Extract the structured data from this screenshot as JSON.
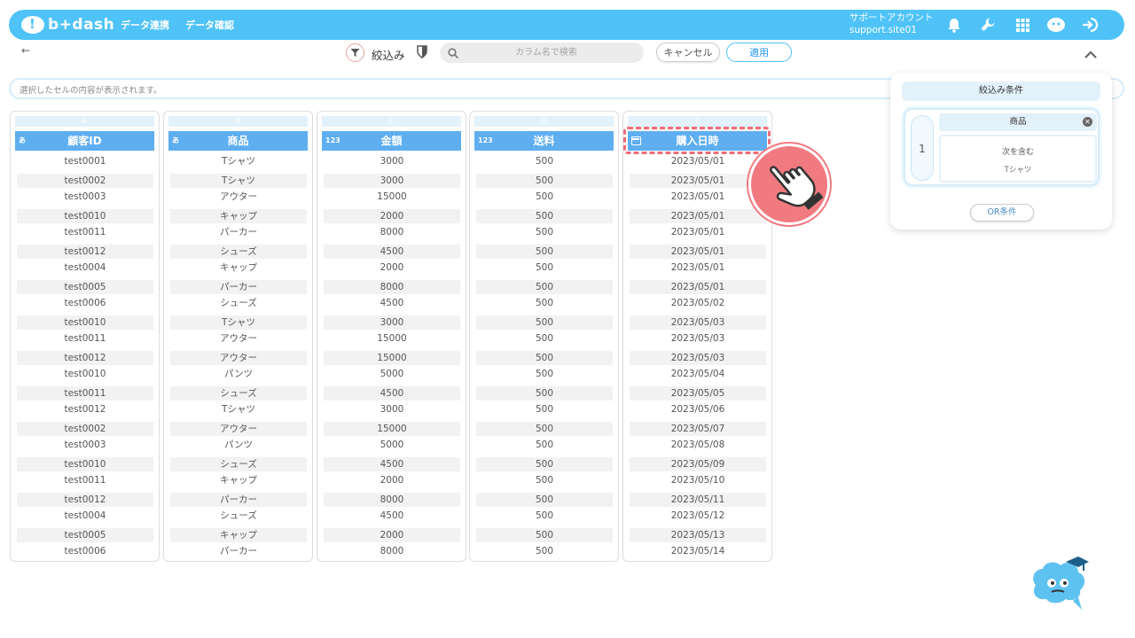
{
  "header": {
    "logo_text": "b+dash",
    "nav": [
      "データ連携",
      "データ確認"
    ],
    "account_name": "サポートアカウント",
    "account_id": "support.site01"
  },
  "toolbar": {
    "back": "←",
    "filter_label": "絞込み",
    "search_placeholder": "カラム名で検索",
    "cancel_label": "キャンセル",
    "apply_label": "適用"
  },
  "info_bar": {
    "text": "選択したセルの内容が表示されます。"
  },
  "columns": [
    {
      "letter": "A",
      "type": "あ",
      "name": "顧客ID",
      "values": [
        "test0001",
        "test0002",
        "test0003",
        "test0010",
        "test0011",
        "test0012",
        "test0004",
        "test0005",
        "test0006",
        "test0010",
        "test0011",
        "test0012",
        "test0010",
        "test0011",
        "test0012",
        "test0002",
        "test0003",
        "test0010",
        "test0011",
        "test0012",
        "test0004",
        "test0005",
        "test0006"
      ]
    },
    {
      "letter": "B",
      "type": "あ",
      "name": "商品",
      "values": [
        "Tシャツ",
        "Tシャツ",
        "アウター",
        "キャップ",
        "パーカー",
        "シューズ",
        "キャップ",
        "パーカー",
        "シューズ",
        "Tシャツ",
        "アウター",
        "アウター",
        "パンツ",
        "シューズ",
        "Tシャツ",
        "アウター",
        "パンツ",
        "シューズ",
        "キャップ",
        "パーカー",
        "シューズ",
        "キャップ",
        "パーカー"
      ]
    },
    {
      "letter": "C",
      "type": "123",
      "name": "金額",
      "values": [
        "3000",
        "3000",
        "15000",
        "2000",
        "8000",
        "4500",
        "2000",
        "8000",
        "4500",
        "3000",
        "15000",
        "15000",
        "5000",
        "4500",
        "3000",
        "15000",
        "5000",
        "4500",
        "2000",
        "8000",
        "4500",
        "2000",
        "8000"
      ]
    },
    {
      "letter": "D",
      "type": "123",
      "name": "送料",
      "values": [
        "500",
        "500",
        "500",
        "500",
        "500",
        "500",
        "500",
        "500",
        "500",
        "500",
        "500",
        "500",
        "500",
        "500",
        "500",
        "500",
        "500",
        "500",
        "500",
        "500",
        "500",
        "500",
        "500"
      ]
    },
    {
      "letter": "E",
      "type": "",
      "name": "購入日時",
      "values": [
        "2023/05/01",
        "2023/05/01",
        "2023/05/01",
        "2023/05/01",
        "2023/05/01",
        "2023/05/01",
        "2023/05/01",
        "2023/05/01",
        "2023/05/02",
        "2023/05/03",
        "2023/05/03",
        "2023/05/03",
        "2023/05/04",
        "2023/05/05",
        "2023/05/06",
        "2023/05/07",
        "2023/05/08",
        "2023/05/09",
        "2023/05/10",
        "2023/05/11",
        "2023/05/12",
        "2023/05/13",
        "2023/05/14"
      ]
    }
  ],
  "filter_panel": {
    "title": "絞込み条件",
    "condition_number": "1",
    "condition_field": "商品",
    "condition_operator": "次を含む",
    "condition_value": "Tシャツ",
    "or_button": "OR条件"
  },
  "colors": {
    "header_bg": "#4fc3f7",
    "column_header": "#5eaef0",
    "highlight": "#f06b7a"
  }
}
